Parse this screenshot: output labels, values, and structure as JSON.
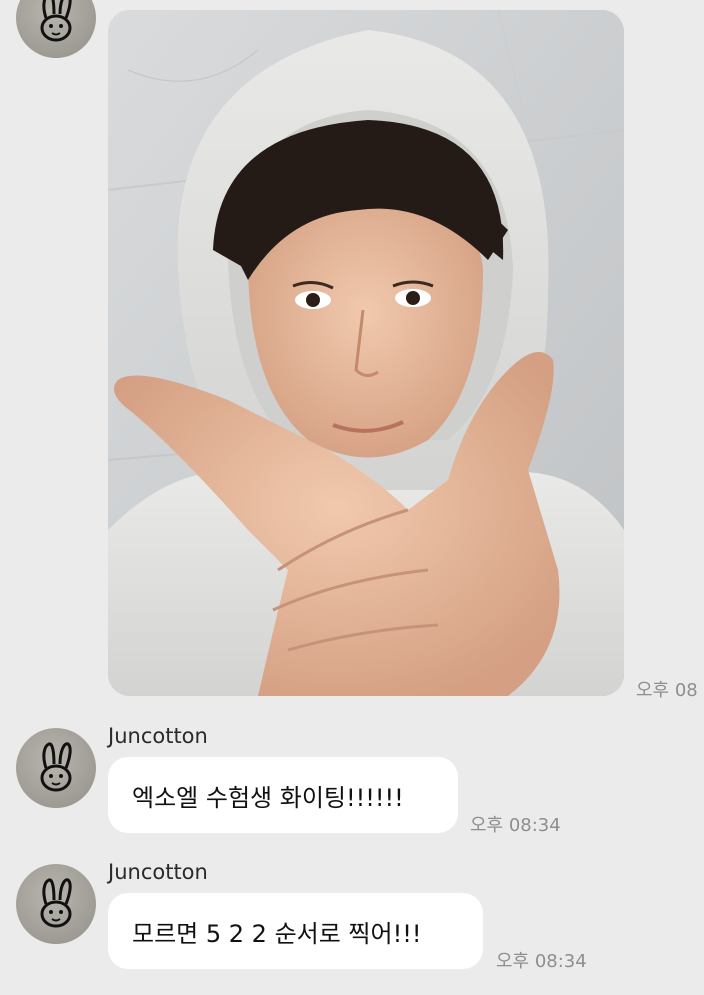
{
  "chat": {
    "photo_message": {
      "time": "오후 08"
    },
    "messages": [
      {
        "sender": "Juncotton",
        "text": "엑소엘 수험생 화이팅!!!!!!",
        "time": "오후 08:34"
      },
      {
        "sender": "Juncotton",
        "text": "모르면 5 2 2 순서로 찍어!!!",
        "time": "오후 08:34"
      }
    ]
  }
}
